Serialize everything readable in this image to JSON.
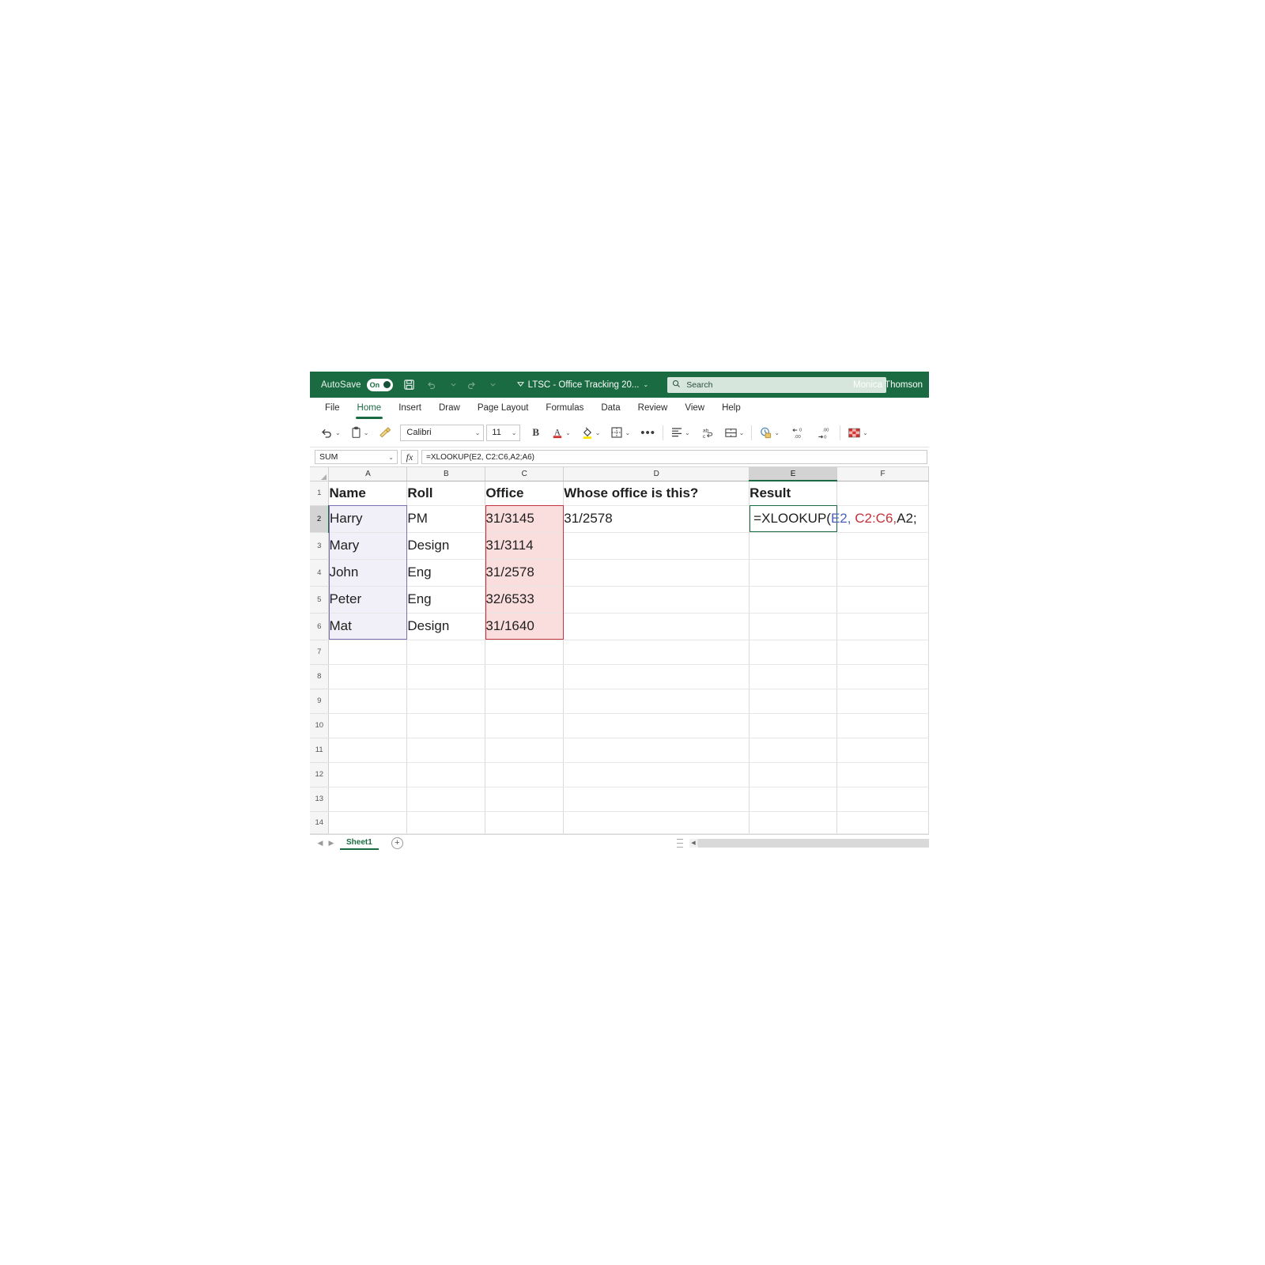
{
  "titlebar": {
    "autosave_label": "AutoSave",
    "autosave_state": "On",
    "save_icon": "save-icon",
    "undo_icon": "undo-icon",
    "redo_icon": "redo-icon",
    "document_title": "LTSC - Office Tracking 20...",
    "search_placeholder": "Search",
    "search_icon": "search-icon",
    "user_name": "Monica Thomson",
    "bar_color": "#1b6b42"
  },
  "ribbon_tabs": [
    {
      "label": "File",
      "active": false
    },
    {
      "label": "Home",
      "active": true
    },
    {
      "label": "Insert",
      "active": false
    },
    {
      "label": "Draw",
      "active": false
    },
    {
      "label": "Page Layout",
      "active": false
    },
    {
      "label": "Formulas",
      "active": false
    },
    {
      "label": "Data",
      "active": false
    },
    {
      "label": "Review",
      "active": false
    },
    {
      "label": "View",
      "active": false
    },
    {
      "label": "Help",
      "active": false
    }
  ],
  "toolbar": {
    "undo_icon": "undo-icon",
    "paste_icon": "clipboard-paste-icon",
    "format_painter_icon": "format-painter-icon",
    "font_name": "Calibri",
    "font_size": "11",
    "bold_label": "B",
    "font_color_icon": "font-color-icon",
    "font_color_swatch": "#d1342f",
    "fill_color_icon": "fill-color-icon",
    "fill_color_swatch": "#ffe600",
    "borders_icon": "borders-icon",
    "more_icon": "ellipsis-icon",
    "align_icon": "align-left-icon",
    "wrap_text_icon": "wrap-text-icon",
    "merge_cells_icon": "merge-cells-icon",
    "number_format_icon": "number-format-icon",
    "decrease_decimal_icon": "decrease-decimal-icon",
    "increase_decimal_icon": "increase-decimal-icon",
    "cell_styles_icon": "cell-styles-icon"
  },
  "formula_bar": {
    "name_box_value": "SUM",
    "fx_label": "fx",
    "formula_value": "=XLOOKUP(E2, C2:C6,A2;A6)"
  },
  "grid": {
    "columns": [
      "A",
      "B",
      "C",
      "D",
      "E",
      "F"
    ],
    "selected_column": "E",
    "selected_row": "2",
    "row_numbers": [
      "1",
      "2",
      "3",
      "4",
      "5",
      "6",
      "7",
      "8",
      "9",
      "10",
      "11",
      "12",
      "13",
      "14"
    ],
    "headers": {
      "a": "Name",
      "b": "Roll",
      "c": "Office",
      "d": "Whose office is this?",
      "e": "Result"
    },
    "rows": [
      {
        "num": "2",
        "a": "Harry",
        "b": "PM",
        "c": "31/3145",
        "d": "31/2578",
        "e": ""
      },
      {
        "num": "3",
        "a": "Mary",
        "b": "Design",
        "c": "31/3114",
        "d": "",
        "e": ""
      },
      {
        "num": "4",
        "a": "John",
        "b": "Eng",
        "c": "31/2578",
        "d": "",
        "e": ""
      },
      {
        "num": "5",
        "a": "Peter",
        "b": "Eng",
        "c": "32/6533",
        "d": "",
        "e": ""
      },
      {
        "num": "6",
        "a": "Mat",
        "b": "Design",
        "c": "31/1640",
        "d": "",
        "e": ""
      }
    ],
    "empty_rows": [
      "7",
      "8",
      "9",
      "10",
      "11",
      "12",
      "13",
      "14"
    ],
    "active_cell_formula": {
      "part_function": "=XLOOKUP(",
      "part_lookup_value": "E2,",
      "part_lookup_array": " C2:C6,",
      "part_return_array": "A2;"
    },
    "range_colors": {
      "lookup_value_ref": "#4a5fc1",
      "lookup_array_ref": "#c4323b",
      "return_array_ref": "#7a6fb0",
      "active_cell_border": "#1b6b42",
      "range_a_fill": "#f1eff7",
      "range_c_fill": "#fadddd"
    }
  },
  "sheetbar": {
    "first_arrow_icon": "nav-first-icon",
    "prev_arrow_icon": "nav-prev-icon",
    "sheet_name": "Sheet1",
    "add_sheet_icon": "add-sheet-icon",
    "add_sheet_label": "+",
    "scroll_left_icon": "scroll-left-icon"
  }
}
